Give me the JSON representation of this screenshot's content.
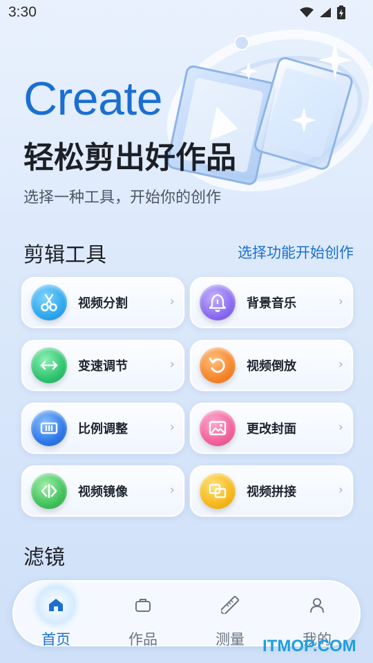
{
  "status_bar": {
    "time": "3:30"
  },
  "hero": {
    "title": "Create",
    "subtitle": "轻松剪出好作品",
    "description": "选择一种工具，开始你的创作"
  },
  "edit_tools": {
    "title": "剪辑工具",
    "link": "选择功能开始创作",
    "items": [
      {
        "label": "视频分割",
        "icon": "scissors-icon",
        "color": "#2fa8ee"
      },
      {
        "label": "背景音乐",
        "icon": "bell-icon",
        "color": "#8a6cf0"
      },
      {
        "label": "变速调节",
        "icon": "arrows-horizontal-icon",
        "color": "#2ec46e"
      },
      {
        "label": "视频倒放",
        "icon": "rewind-icon",
        "color": "#f5862a"
      },
      {
        "label": "比例调整",
        "icon": "ratio-icon",
        "color": "#2d78e8"
      },
      {
        "label": "更改封面",
        "icon": "image-icon",
        "color": "#f0629c"
      },
      {
        "label": "视频镜像",
        "icon": "mirror-icon",
        "color": "#43c25c"
      },
      {
        "label": "视频拼接",
        "icon": "merge-icon",
        "color": "#f5b81c"
      }
    ],
    "chevron": "›"
  },
  "filters": {
    "title": "滤镜"
  },
  "bottom_nav": {
    "items": [
      {
        "label": "首页",
        "icon": "home-icon"
      },
      {
        "label": "作品",
        "icon": "briefcase-icon"
      },
      {
        "label": "测量",
        "icon": "ruler-icon"
      },
      {
        "label": "我的",
        "icon": "user-icon"
      }
    ]
  },
  "watermark": "ITMOP.COM"
}
